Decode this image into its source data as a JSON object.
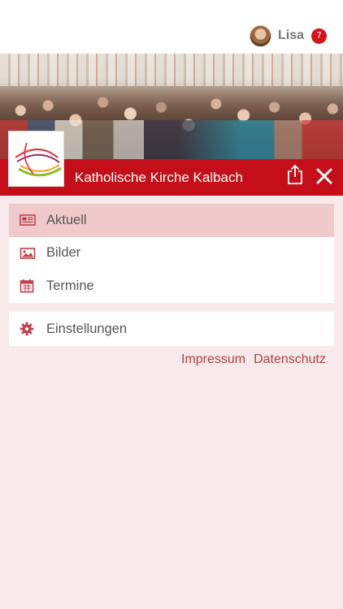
{
  "header": {
    "user_name": "Lisa",
    "notification_count": "7",
    "icons": {
      "avatar": "user-avatar-photo"
    }
  },
  "banner": {
    "title": "Katholische Kirche Kalbach",
    "icons": {
      "share": "share-icon",
      "close": "close-icon",
      "logo": "parish-logo"
    }
  },
  "menu": {
    "items": [
      {
        "label": "Aktuell",
        "icon": "newspaper-icon",
        "active": true
      },
      {
        "label": "Bilder",
        "icon": "image-icon",
        "active": false
      },
      {
        "label": "Termine",
        "icon": "calendar-icon",
        "active": false
      }
    ],
    "settings": {
      "label": "Einstellungen",
      "icon": "gear-icon"
    }
  },
  "footer": {
    "impressum": "Impressum",
    "datenschutz": "Datenschutz"
  },
  "colors": {
    "accent": "#c40f1a",
    "active_item": "#f0caca",
    "background": "#f8eaea",
    "link": "#b0404a",
    "badge": "#d0141d"
  }
}
